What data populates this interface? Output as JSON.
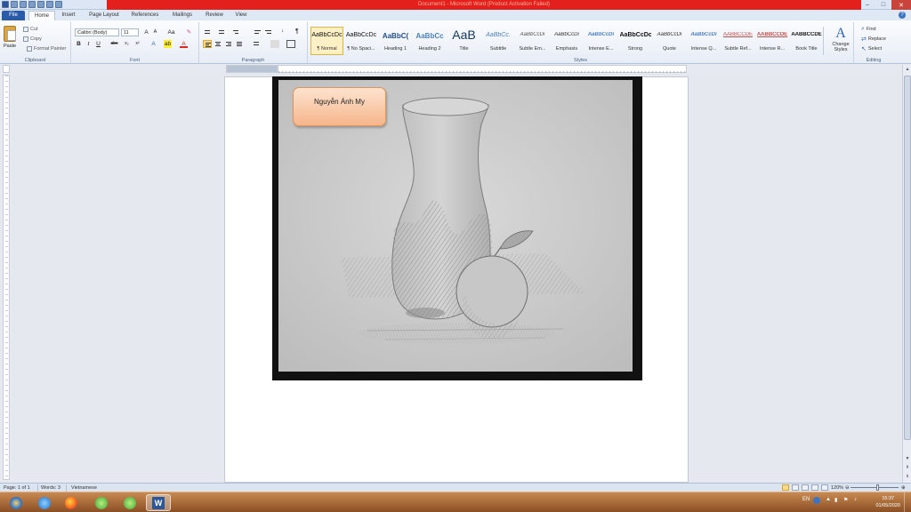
{
  "titlebar": {
    "title": "Document1 - Microsoft Word (Product Activation Failed)"
  },
  "tabs": [
    "File",
    "Home",
    "Insert",
    "Page Layout",
    "References",
    "Mailings",
    "Review",
    "View"
  ],
  "active_tab": "Home",
  "clipboard": {
    "paste": "Paste",
    "cut": "Cut",
    "copy": "Copy",
    "format_painter": "Format Painter",
    "label": "Clipboard"
  },
  "font": {
    "family": "Calibri (Body)",
    "size": "11",
    "label": "Font"
  },
  "paragraph": {
    "label": "Paragraph"
  },
  "styles": {
    "label": "Styles",
    "items": [
      {
        "sample": "AaBbCcDc",
        "name": "¶ Normal",
        "active": true
      },
      {
        "sample": "AaBbCcDc",
        "name": "¶ No Spaci..."
      },
      {
        "sample": "AaBbC(",
        "name": "Heading 1"
      },
      {
        "sample": "AaBbCc",
        "name": "Heading 2"
      },
      {
        "sample": "AaB",
        "name": "Title"
      },
      {
        "sample": "AaBbCc.",
        "name": "Subtitle"
      },
      {
        "sample": "AaBbCcDi",
        "name": "Subtle Em..."
      },
      {
        "sample": "AaBbCcDi",
        "name": "Emphasis"
      },
      {
        "sample": "AaBbCcDi",
        "name": "Intense E..."
      },
      {
        "sample": "AaBbCcDc",
        "name": "Strong"
      },
      {
        "sample": "AaBbCcDi",
        "name": "Quote"
      },
      {
        "sample": "AaBbCcDi",
        "name": "Intense Q..."
      },
      {
        "sample": "AABBCCDE",
        "name": "Subtle Ref..."
      },
      {
        "sample": "AABBCCDE",
        "name": "Intense R..."
      },
      {
        "sample": "AABBCCDE",
        "name": "Book Title"
      }
    ],
    "change_styles": "Change Styles"
  },
  "editing": {
    "find": "Find",
    "replace": "Replace",
    "select": "Select",
    "label": "Editing"
  },
  "document": {
    "name_box_text": "Nguyễn Ánh My"
  },
  "statusbar": {
    "page": "Page: 1 of 1",
    "words": "Words: 3",
    "language": "Vietnamese",
    "zoom": "120%"
  },
  "taskbar": {
    "lang": "EN",
    "time": "15:37",
    "date": "01/05/2020"
  }
}
